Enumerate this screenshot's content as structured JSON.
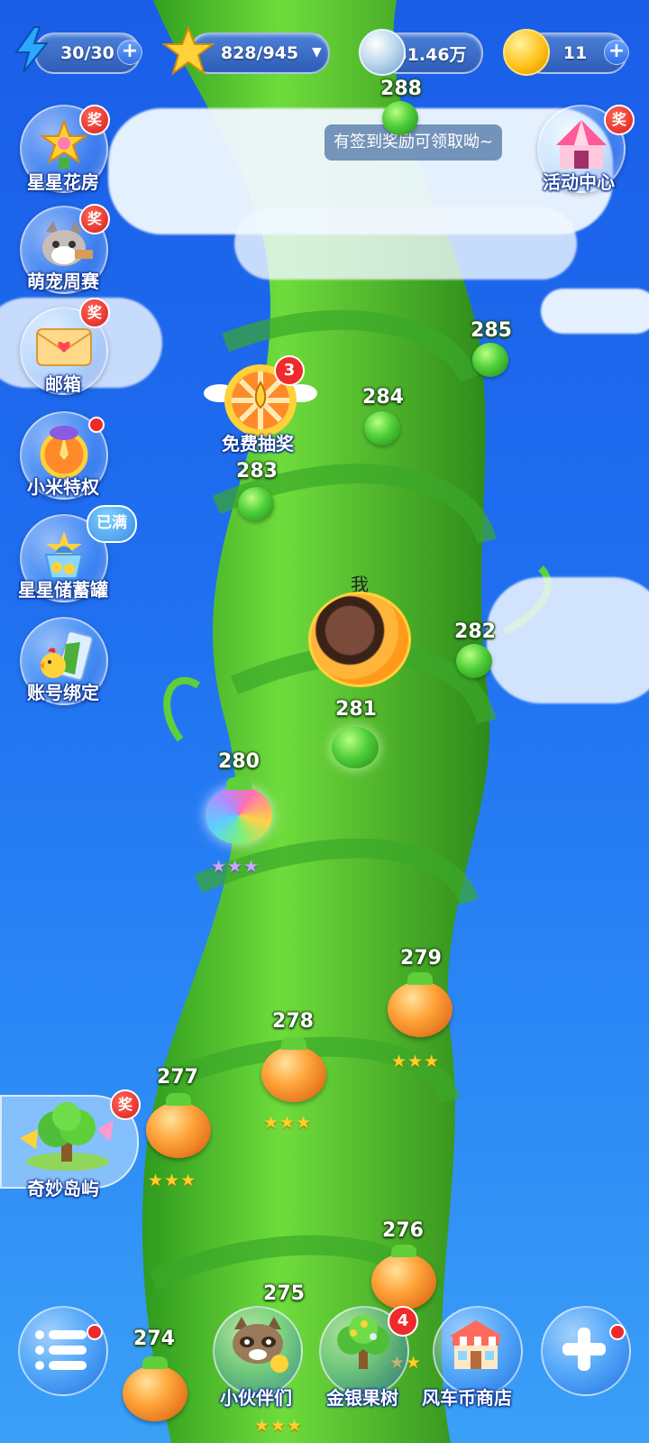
{
  "resources": {
    "energy": {
      "value": "30/30",
      "icon": "lightning-icon"
    },
    "stars": {
      "value": "828/945",
      "icon": "star-icon"
    },
    "pearls": {
      "value": "51.46万",
      "icon": "pearl-icon"
    },
    "coins": {
      "value": "11",
      "icon": "coin-icon"
    }
  },
  "tooltip": "有签到奖励可领取呦~",
  "prize_badge": "奖",
  "full_badge": "已满",
  "side_left": [
    {
      "label": "星星花房",
      "icon": "flower-house-icon"
    },
    {
      "label": "萌宠周赛",
      "icon": "cat-icon"
    },
    {
      "label": "邮箱",
      "icon": "mail-icon"
    },
    {
      "label": "小米特权",
      "icon": "privilege-icon"
    },
    {
      "label": "星星储蓄罐",
      "icon": "piggy-bank-icon"
    },
    {
      "label": "账号绑定",
      "icon": "account-bind-icon"
    }
  ],
  "side_right": {
    "label": "活动中心",
    "icon": "circus-tent-icon"
  },
  "island": {
    "label": "奇妙岛屿",
    "icon": "tree-island-icon"
  },
  "lucky_draw": {
    "label": "免费抽奖",
    "count": "3",
    "icon": "wheel-icon"
  },
  "player": {
    "label": "我",
    "current_level": "281",
    "icon": "avatar-icon"
  },
  "levels": [
    {
      "num": "288",
      "stars": ""
    },
    {
      "num": "285",
      "stars": ""
    },
    {
      "num": "284",
      "stars": ""
    },
    {
      "num": "283",
      "stars": ""
    },
    {
      "num": "282",
      "stars": ""
    },
    {
      "num": "281",
      "stars": ""
    },
    {
      "num": "280",
      "stars": "★★★"
    },
    {
      "num": "279",
      "stars": "★★★"
    },
    {
      "num": "278",
      "stars": "★★★"
    },
    {
      "num": "277",
      "stars": "★★★"
    },
    {
      "num": "276",
      "stars": "★★"
    },
    {
      "num": "275",
      "stars": ""
    },
    {
      "num": "274",
      "stars": "★★★"
    }
  ],
  "bottom": {
    "menu": {
      "icon": "menu-icon"
    },
    "partners": {
      "label": "小伙伴们",
      "icon": "raccoon-icon"
    },
    "tree": {
      "label": "金银果树",
      "count": "4",
      "icon": "fruit-tree-icon"
    },
    "shop": {
      "label": "风车币商店",
      "icon": "shop-icon"
    },
    "add": {
      "icon": "plus-icon"
    }
  }
}
